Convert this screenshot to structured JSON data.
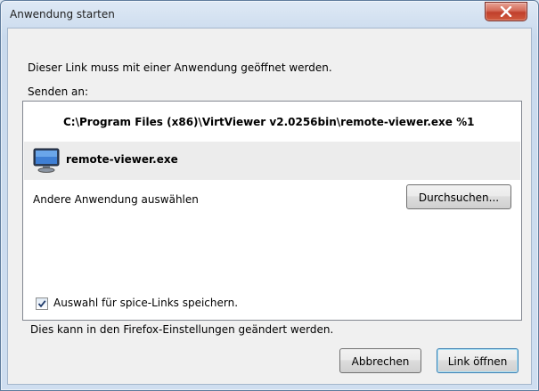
{
  "window": {
    "title": "Anwendung starten"
  },
  "dialog": {
    "message": "Dieser Link muss mit einer Anwendung geöffnet werden.",
    "send_to_label": "Senden an:",
    "list": {
      "command_path": "C:\\Program Files (x86)\\VirtViewer v2.0256bin\\remote-viewer.exe %1",
      "selected_app": "remote-viewer.exe",
      "other_app_label": "Andere Anwendung auswählen",
      "browse_button": "Durchsuchen..."
    },
    "remember_checkbox": {
      "label": "Auswahl für spice-Links speichern.",
      "checked": true
    },
    "settings_hint": "Dies kann in den Firefox-Einstellungen geändert werden.",
    "buttons": {
      "cancel": "Abbrechen",
      "open": "Link öffnen"
    }
  }
}
